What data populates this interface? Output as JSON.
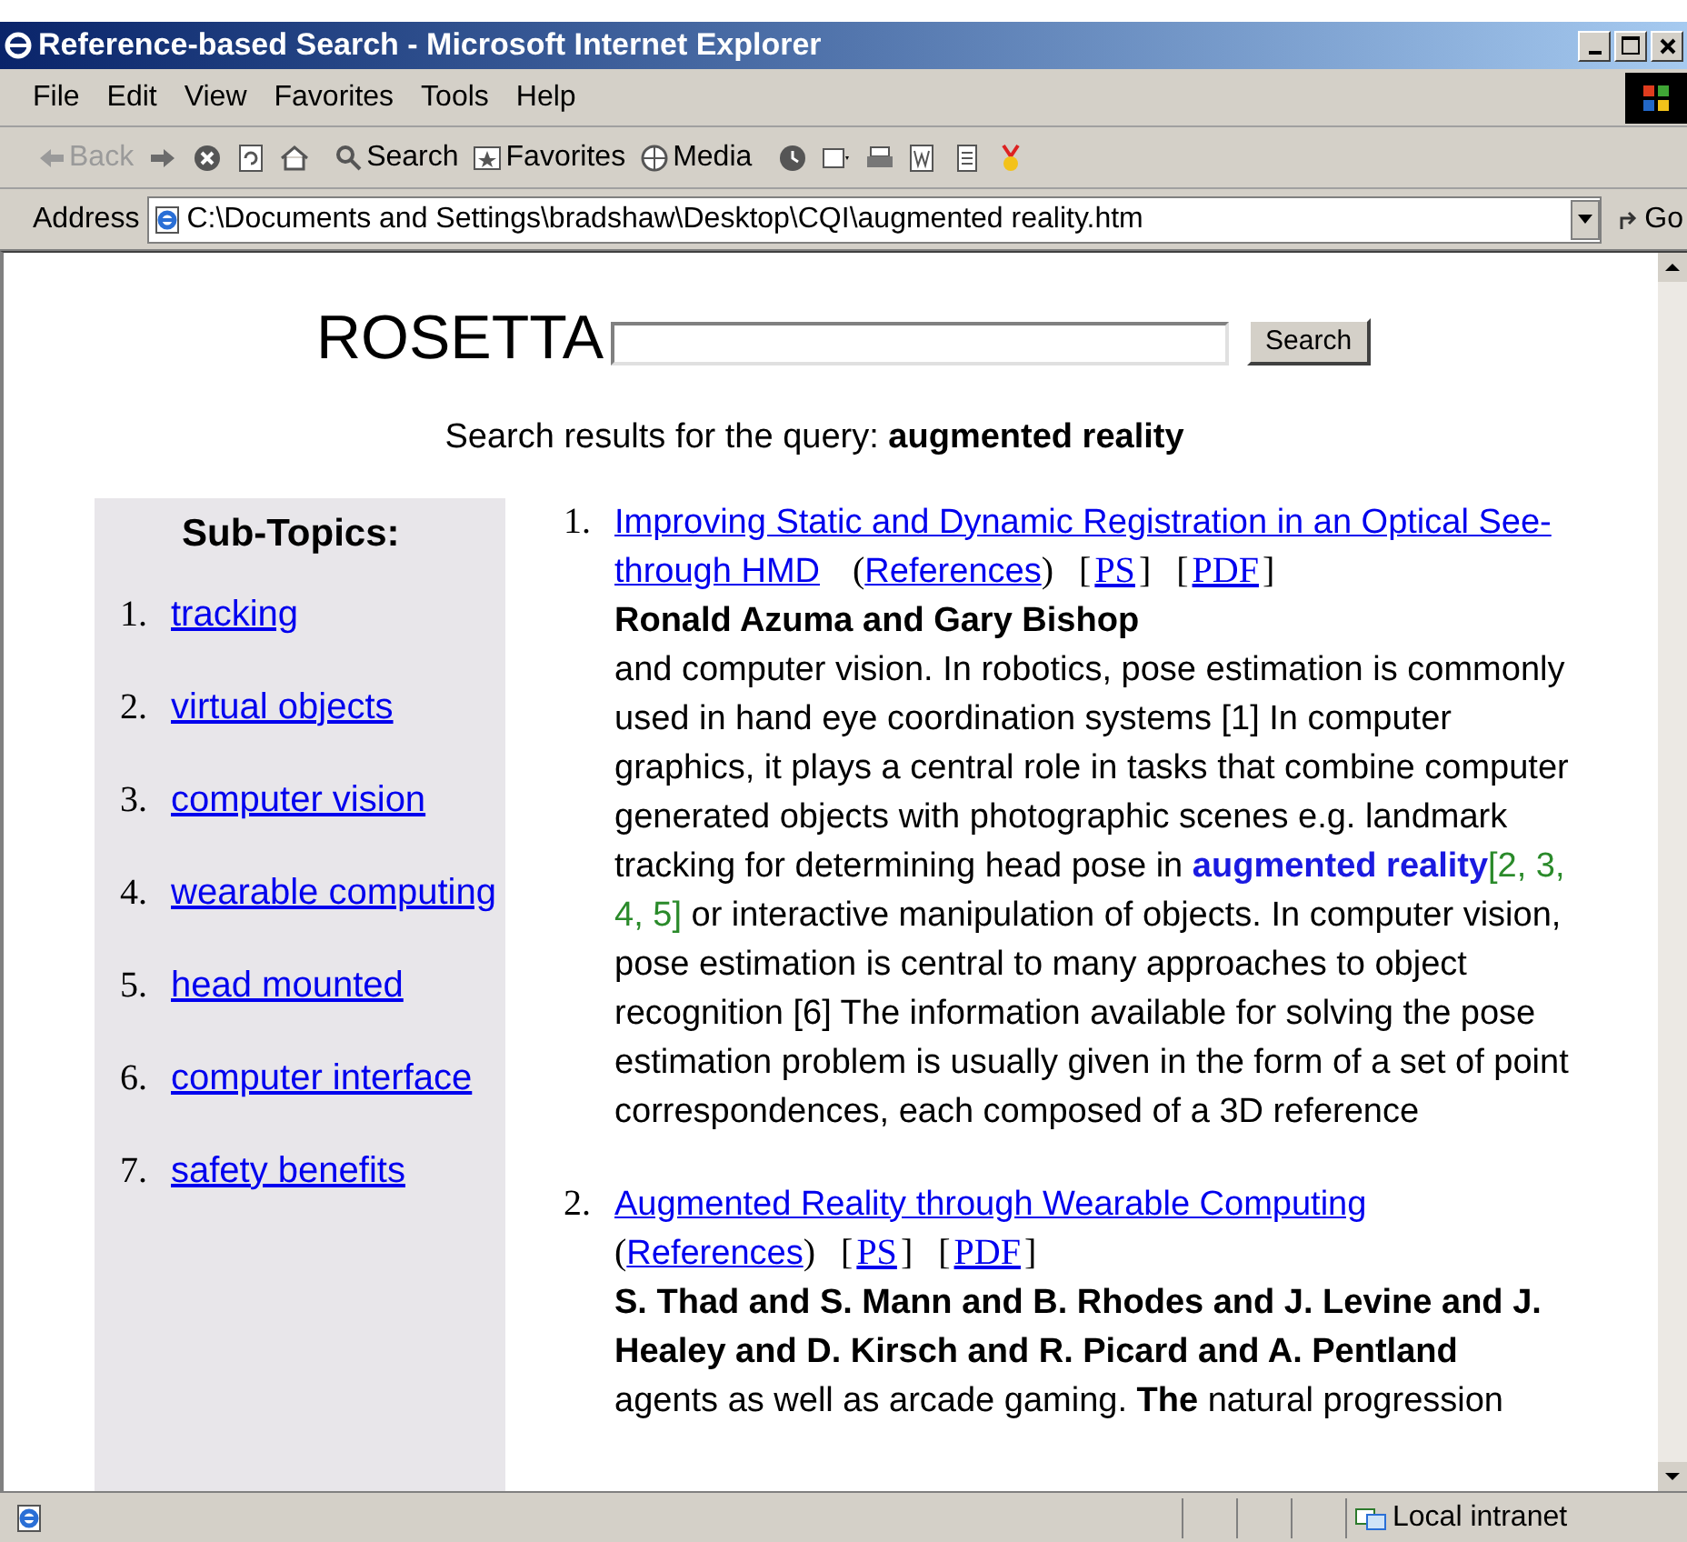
{
  "window": {
    "title": "Reference-based Search - Microsoft Internet Explorer"
  },
  "menu": [
    "File",
    "Edit",
    "View",
    "Favorites",
    "Tools",
    "Help"
  ],
  "toolbar": [
    {
      "kind": "back",
      "label": "Back",
      "disabled": true
    },
    {
      "kind": "forward",
      "disabled": false
    },
    {
      "kind": "stop",
      "disabled": false
    },
    {
      "kind": "refresh",
      "disabled": false
    },
    {
      "kind": "home",
      "disabled": false
    },
    {
      "kind": "search",
      "label": "Search",
      "disabled": false
    },
    {
      "kind": "favorites",
      "label": "Favorites",
      "disabled": false
    },
    {
      "kind": "media",
      "label": "Media",
      "disabled": false
    },
    {
      "kind": "history",
      "disabled": false
    },
    {
      "kind": "mail",
      "disabled": false
    },
    {
      "kind": "print",
      "disabled": false
    },
    {
      "kind": "edit",
      "disabled": false
    },
    {
      "kind": "discuss",
      "disabled": false
    },
    {
      "kind": "medal",
      "disabled": false
    }
  ],
  "address": {
    "label": "Address",
    "value": "C:\\Documents and Settings\\bradshaw\\Desktop\\CQI\\augmented reality.htm",
    "go": "Go"
  },
  "page": {
    "logo": "ROSETTA",
    "search_button": "Search",
    "query_prefix": "Search results for the query:",
    "query": "augmented reality",
    "subtopics": {
      "heading": "Sub-Topics:",
      "items": [
        {
          "number": "1.",
          "label": "tracking"
        },
        {
          "number": "2.",
          "label": "virtual objects"
        },
        {
          "number": "3.",
          "label": "computer vision"
        },
        {
          "number": "4.",
          "label": "wearable computing"
        },
        {
          "number": "5.",
          "label": "head mounted"
        },
        {
          "number": "6.",
          "label": "computer interface"
        },
        {
          "number": "7.",
          "label": "safety benefits"
        }
      ]
    },
    "results": [
      {
        "number": "1.",
        "title_lines": [
          "Improving Static and Dynamic Registration in an Optical See-",
          "through HMD"
        ],
        "links": [
          {
            "kind": "references",
            "before": "(",
            "label": "References",
            "after": ")"
          },
          {
            "kind": "ps",
            "before": "[",
            "label": "PS",
            "after": "]"
          },
          {
            "kind": "pdf",
            "before": "[",
            "label": "PDF",
            "after": "]"
          }
        ],
        "authors": "Ronald Azuma and Gary Bishop",
        "snippet": [
          {
            "kind": "text",
            "text": "and computer vision. In robotics, pose estimation is commonly used in hand eye coordination systems [1] In computer graphics, it plays a central role in tasks that combine computer generated objects with photographic scenes e.g. landmark tracking for determining head pose in "
          },
          {
            "kind": "highlight",
            "text": "augmented reality"
          },
          {
            "kind": "citation",
            "text": "[2, 3, 4, 5]"
          },
          {
            "kind": "text",
            "text": " or interactive manipulation of objects. In computer vision, pose estimation is central to many approaches to object recognition [6] The information available for solving the pose estimation problem is usually given in the form of a set of point correspondences, each composed of a 3D reference"
          }
        ]
      },
      {
        "number": "2.",
        "title_lines": [
          "Augmented Reality through Wearable Computing"
        ],
        "links": [
          {
            "kind": "references",
            "before": "(",
            "label": "References",
            "after": ")"
          },
          {
            "kind": "ps",
            "before": "[",
            "label": "PS",
            "after": "]"
          },
          {
            "kind": "pdf",
            "before": "[",
            "label": "PDF",
            "after": "]"
          }
        ],
        "authors": "S. Thad and S. Mann and B. Rhodes and J. Levine and J. Healey and D. Kirsch and R. Picard and A. Pentland",
        "snippet": [
          {
            "kind": "text",
            "text": "agents as well as arcade gaming. **The** natural progression"
          }
        ]
      }
    ]
  },
  "status_bar": {
    "zone": "Local intranet"
  }
}
